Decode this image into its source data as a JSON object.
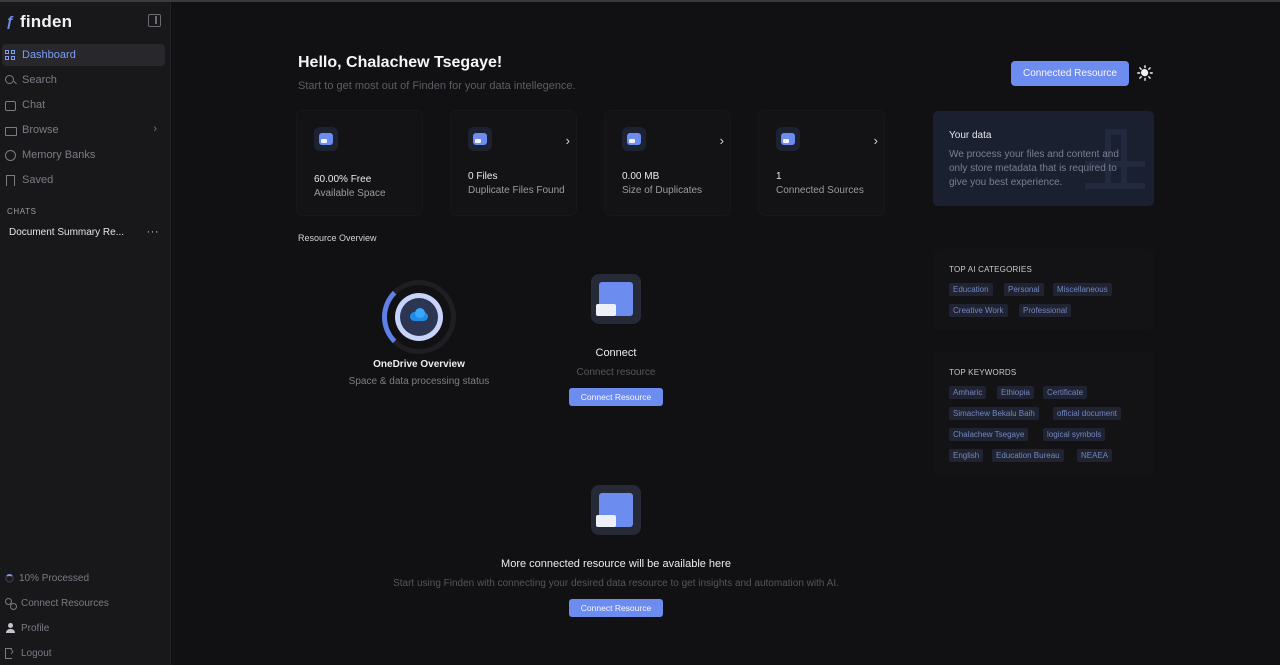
{
  "brand": {
    "name": "finden"
  },
  "sidebar": {
    "items": [
      {
        "label": "Dashboard",
        "icon": "grid-icon"
      },
      {
        "label": "Search",
        "icon": "search-icon"
      },
      {
        "label": "Chat",
        "icon": "chat-icon"
      },
      {
        "label": "Browse",
        "icon": "folder-icon"
      },
      {
        "label": "Memory Banks",
        "icon": "brain-icon"
      },
      {
        "label": "Saved",
        "icon": "bookmark-icon"
      }
    ],
    "chats_heading": "CHATS",
    "chats": [
      {
        "title": "Document Summary Re...",
        "more": "···"
      }
    ],
    "bottom": [
      {
        "label": "10% Processed",
        "progress": 0.1
      },
      {
        "label": "Connect Resources"
      },
      {
        "label": "Profile"
      },
      {
        "label": "Logout"
      }
    ]
  },
  "header": {
    "greeting": "Hello, Chalachew Tsegaye!",
    "subtitle": "Start to get most out of Finden for your data intellegence.",
    "connected_button": "Connected Resource"
  },
  "stats": [
    {
      "value": "60.00% Free",
      "label": "Available Space",
      "has_arrow": false
    },
    {
      "value": "0 Files",
      "label": "Duplicate Files Found",
      "has_arrow": true
    },
    {
      "value": "0.00 MB",
      "label": "Size of Duplicates",
      "has_arrow": true
    },
    {
      "value": "1",
      "label": "Connected Sources",
      "has_arrow": true
    }
  ],
  "resource_overview": {
    "heading": "Resource Overview",
    "onedrive": {
      "title": "OneDrive Overview",
      "subtitle": "Space & data processing status"
    },
    "connect": {
      "title": "Connect",
      "subtitle": "Connect resource",
      "button": "Connect Resource"
    },
    "more": {
      "title": "More connected resource will be available here",
      "subtitle": "Start using Finden with connecting your desired data resource to get insights and automation with AI.",
      "button": "Connect Resource"
    }
  },
  "your_data": {
    "title": "Your data",
    "body": "We process your files and content and only store metadata that is required to give you best experience."
  },
  "top_ai_categories": {
    "heading": "TOP AI CATEGORIES",
    "tags": [
      "Education",
      "Personal",
      "Miscellaneous",
      "Creative Work",
      "Professional"
    ]
  },
  "top_keywords": {
    "heading": "TOP KEYWORDS",
    "tags": [
      "Amharic",
      "Ethiopia",
      "Certificate",
      "Simachew Bekalu Baih",
      "official document",
      "Chalachew Tsegaye",
      "logical symbols",
      "English",
      "Education Bureau",
      "NEAEA"
    ]
  },
  "colors": {
    "accent": "#6d8cf0",
    "background": "#111113",
    "sidebar": "#18181b"
  }
}
